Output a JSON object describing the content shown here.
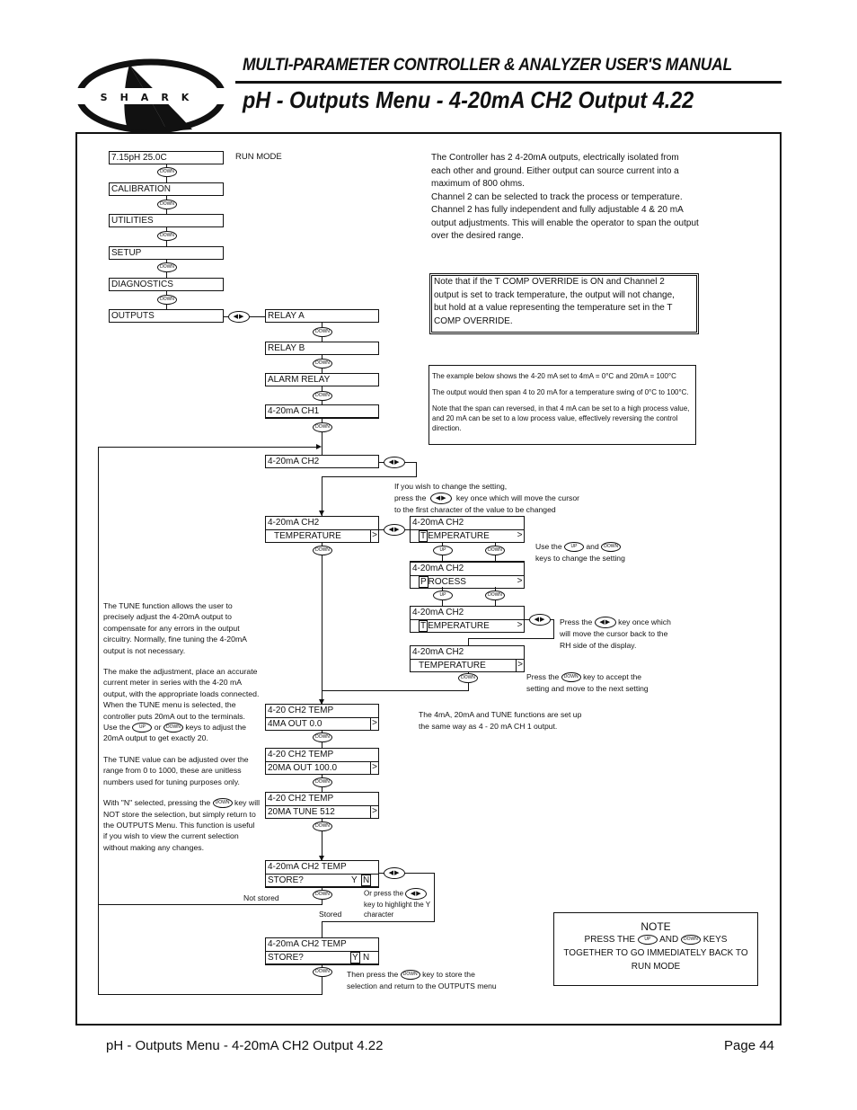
{
  "header": {
    "logo_text": "S H A R K",
    "manual_title": "MULTI-PARAMETER CONTROLLER & ANALYZER USER'S MANUAL",
    "page_title": "pH - Outputs Menu - 4-20mA CH2 Output 4.22"
  },
  "keys": {
    "down": "DOWN",
    "up": "UP",
    "leftright": "◀▶"
  },
  "main_menu": {
    "run_mode_display": "7.15pH   25.0C",
    "run_mode_label": "RUN MODE",
    "items": [
      "CALIBRATION",
      "UTILITIES",
      "SETUP",
      "DIAGNOSTICS",
      "OUTPUTS"
    ]
  },
  "outputs_menu": {
    "items": [
      "RELAY A",
      "RELAY B",
      "ALARM RELAY",
      "4-20mA CH1",
      "4-20mA CH2"
    ]
  },
  "intro_text": [
    "The Controller has 2 4-20mA outputs, electrically isolated from each other and ground. Either output can source current into a maximum of 800 ohms.",
    "Channel 2 can be selected to track the process or temperature.",
    "Channel 2 has fully independent and fully adjustable 4 & 20 mA output adjustments. This will enable the operator to span the output over the desired range."
  ],
  "tcomp_note": "Note that if the T COMP OVERRIDE is ON and Channel 2 output is set to track temperature, the output will not change, but hold at a value representing the temperature set in the T COMP OVERRIDE.",
  "example_note": [
    "The example below shows the 4-20 mA set to 4mA = 0°C and 20mA = 100°C",
    "The output would then span 4 to 20 mA for a temperature swing of 0°C to 100°C.",
    "Note that the span can reversed, in that 4 mA can be set to a high process value, and 20 mA can be set to a low process value, effectively reversing the control direction."
  ],
  "change_hint": {
    "line1": "If you wish to change the setting,",
    "line2a": "press the",
    "line2b": "key once which will move the cursor",
    "line3": "to the first character of the value to be changed"
  },
  "ch2_source": {
    "title": "4-20mA CH2",
    "value": "TEMPERATURE",
    "cursor_t": "T",
    "rest_t": "EMPERATURE",
    "cursor_p": "P",
    "rest_p": "ROCESS",
    "arrow": ">"
  },
  "use_keys_hint": {
    "a": "Use the",
    "b": "and",
    "c": "keys to change the setting"
  },
  "press_lr_hint": {
    "a": "Press the",
    "b": "key once which will move the cursor back to the RH side of the display."
  },
  "press_down_hint": {
    "a": "Press the",
    "b": "key to accept the setting and move to the next setting"
  },
  "tune_text": {
    "p1": "The TUNE function allows the user to precisely adjust the 4-20mA output to compensate for any errors in the output circuitry. Normally, fine tuning the 4-20mA output is not necessary.",
    "p2a": "The make the adjustment, place an accurate current meter in series with the 4-20 mA output, with the appropriate loads connected.  When the TUNE menu is selected, the controller puts 20mA out to the terminals. Use the",
    "p2b": "or",
    "p2c": "keys to adjust the 20mA output to get exactly 20.",
    "p3": "The TUNE value can be adjusted over the range from 0 to 1000, these are unitless numbers used for tuning purposes only.",
    "p4a": "With \"N\" selected, pressing the",
    "p4b": "key will NOT store the selection, but simply return to the OUTPUTS Menu. This function is useful if you wish to view the current selection without making any changes."
  },
  "settings": [
    {
      "title": "4-20 CH2   TEMP",
      "value": "4MA  OUT  0.0"
    },
    {
      "title": "4-20 CH2   TEMP",
      "value": "20MA OUT 100.0"
    },
    {
      "title": "4-20 CH2   TEMP",
      "value": "20MA  TUNE 512"
    }
  ],
  "same_way_note": "The 4mA, 20mA and TUNE functions are set up the same way as 4 - 20 mA CH 1 output.",
  "store": {
    "title": "4-20mA CH2 TEMP",
    "prompt": "STORE?",
    "y": "Y",
    "n": "N",
    "not_stored": "Not stored",
    "stored": "Stored",
    "or_press_a": "Or press the",
    "or_press_b": "key to highlight the Y character",
    "then_press_a": "Then press the",
    "then_press_b": "key to store the selection and return to the OUTPUTS menu"
  },
  "note_box": {
    "title": "NOTE",
    "line1a": "PRESS THE",
    "line1b": "AND",
    "line1c": "KEYS",
    "line2": "TOGETHER TO GO IMMEDIATELY BACK TO",
    "line3": "RUN MODE"
  },
  "footer": {
    "left": "pH - Outputs Menu - 4-20mA CH2 Output 4.22",
    "right": "Page 44"
  }
}
